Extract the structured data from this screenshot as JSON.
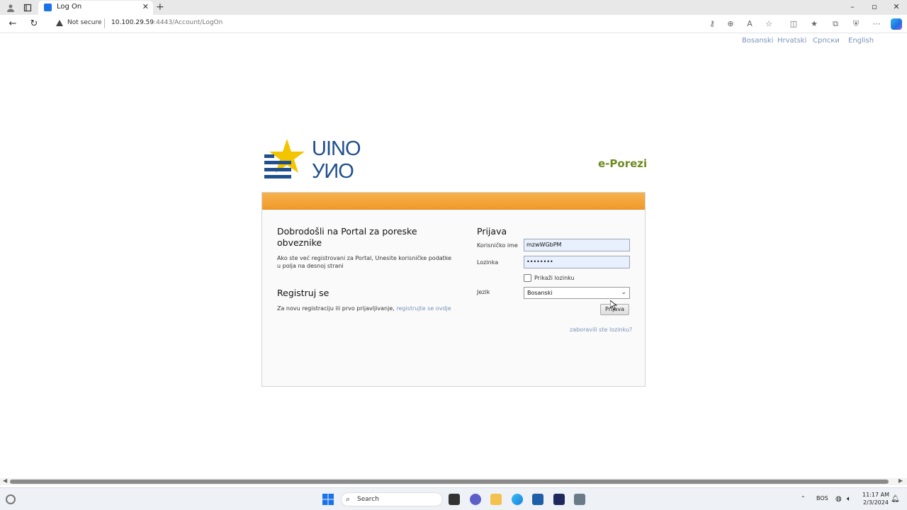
{
  "browser": {
    "tab_title": "Log On",
    "security_label": "Not secure",
    "url_host": "10.100.29.59",
    "url_rest": ":4443/Account/LogOn"
  },
  "languages": [
    "Bosanski",
    "Hrvatski",
    "Српски",
    "English"
  ],
  "header": {
    "logo_text_latin": "UINO",
    "logo_text_cyrillic": "УИО",
    "app_name": "e-Porezi"
  },
  "welcome": {
    "title": "Dobrodošli na Portal za poreske obveznike",
    "subtitle": "Ako ste već registrovani za Portal, Unesite korisničke podatke u polja na desnoj strani"
  },
  "register": {
    "title": "Registruj se",
    "text": "Za novu registraciju ili prvo prijavljivanje, ",
    "link": "registrujte se ovdje"
  },
  "login": {
    "title": "Prijava",
    "username_label": "Korisničko ime",
    "username_value": "mzwWGbPM",
    "password_label": "Lozinka",
    "password_value": "••••••••",
    "show_password_label": "Prikaži lozinku",
    "language_label": "Jezik",
    "language_value": "Bosanski",
    "submit_label": "Prijava",
    "forgot_link": "zaboravili ste lozinku?"
  },
  "taskbar": {
    "search_label": "Search",
    "input_lang": "BOS",
    "time": "11:17 AM",
    "date": "2/3/2024"
  },
  "colors": {
    "accent_orange": "#f09a2a",
    "eporezi_green": "#6e8b1e",
    "link_blue": "#7a93b8",
    "logo_yellow": "#f2c500",
    "logo_blue": "#1f4f8c"
  }
}
